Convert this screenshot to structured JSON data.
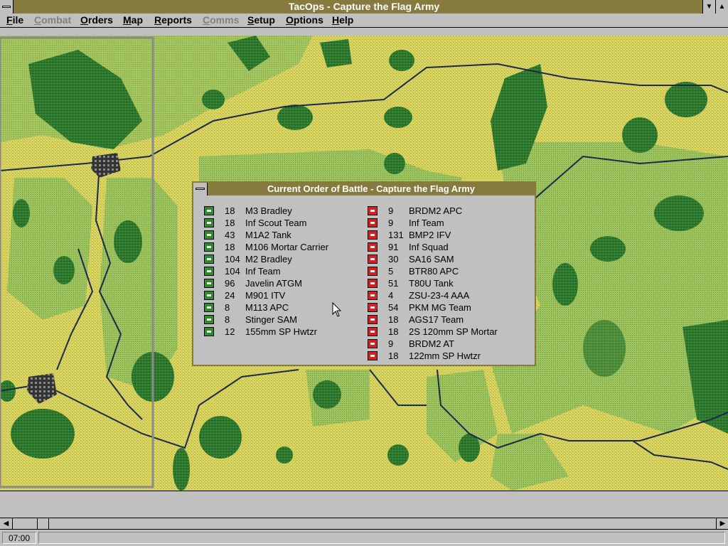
{
  "window": {
    "title": "TacOps - Capture the Flag Army"
  },
  "menu": [
    {
      "label": "File",
      "enabled": true
    },
    {
      "label": "Combat",
      "enabled": false
    },
    {
      "label": "Orders",
      "enabled": true
    },
    {
      "label": "Map",
      "enabled": true
    },
    {
      "label": "Reports",
      "enabled": true
    },
    {
      "label": "Comms",
      "enabled": false
    },
    {
      "label": "Setup",
      "enabled": true
    },
    {
      "label": "Options",
      "enabled": true
    },
    {
      "label": "Help",
      "enabled": true
    }
  ],
  "order_of_battle": {
    "title": "Current Order of Battle - Capture the Flag Army",
    "us_units": [
      {
        "count": "18",
        "name": "M3 Bradley"
      },
      {
        "count": "18",
        "name": "Inf Scout Team"
      },
      {
        "count": "43",
        "name": "M1A2 Tank"
      },
      {
        "count": "18",
        "name": "M106 Mortar Carrier"
      },
      {
        "count": "104",
        "name": "M2 Bradley"
      },
      {
        "count": "104",
        "name": "Inf Team"
      },
      {
        "count": "96",
        "name": "Javelin ATGM"
      },
      {
        "count": "24",
        "name": "M901 ITV"
      },
      {
        "count": "8",
        "name": "M113 APC"
      },
      {
        "count": "8",
        "name": "Stinger SAM"
      },
      {
        "count": "12",
        "name": "155mm SP Hwtzr"
      }
    ],
    "opfor_units": [
      {
        "count": "9",
        "name": "BRDM2 APC"
      },
      {
        "count": "9",
        "name": "Inf Team"
      },
      {
        "count": "131",
        "name": "BMP2 IFV"
      },
      {
        "count": "91",
        "name": "Inf Squad"
      },
      {
        "count": "30",
        "name": "SA16 SAM"
      },
      {
        "count": "5",
        "name": "BTR80 APC"
      },
      {
        "count": "51",
        "name": "T80U Tank"
      },
      {
        "count": "4",
        "name": "ZSU-23-4 AAA"
      },
      {
        "count": "54",
        "name": "PKM MG Team"
      },
      {
        "count": "18",
        "name": "AGS17 Team"
      },
      {
        "count": "18",
        "name": "2S 120mm SP Mortar"
      },
      {
        "count": "9",
        "name": "BRDM2 AT"
      },
      {
        "count": "18",
        "name": "122mm SP Hwtzr"
      }
    ]
  },
  "status": {
    "time": "07:00"
  },
  "colors": {
    "titlebar": "#867a3e",
    "map_open": "#d9d460",
    "map_forest": "#2f7a2f",
    "map_light_green": "#8fbf55",
    "us_unit": "#2e8b2e",
    "opfor_unit": "#d42020"
  }
}
